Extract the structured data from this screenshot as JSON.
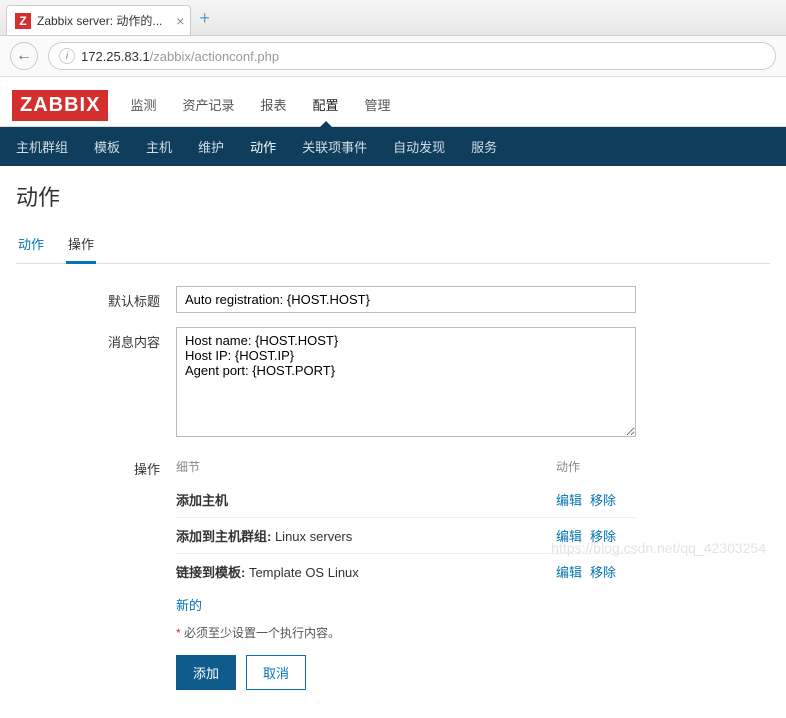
{
  "browser": {
    "tab_title": "Zabbix server: 动作的...",
    "favicon_letter": "Z",
    "url_host": "172.25.83.1",
    "url_path": "/zabbix/actionconf.php"
  },
  "header": {
    "logo": "ZABBIX",
    "top_nav": [
      "监测",
      "资产记录",
      "报表",
      "配置",
      "管理"
    ],
    "top_nav_active": 3,
    "sub_nav": [
      "主机群组",
      "模板",
      "主机",
      "维护",
      "动作",
      "关联项事件",
      "自动发现",
      "服务"
    ],
    "sub_nav_active": 4
  },
  "page": {
    "title": "动作",
    "inner_tabs": [
      "动作",
      "操作"
    ],
    "inner_tab_active": 1
  },
  "form": {
    "labels": {
      "subject": "默认标题",
      "message": "消息内容",
      "operations": "操作"
    },
    "subject_value": "Auto registration: {HOST.HOST}",
    "message_value": "Host name: {HOST.HOST}\nHost IP: {HOST.IP}\nAgent port: {HOST.PORT}",
    "op_head_detail": "细节",
    "op_head_action": "动作",
    "operations": [
      {
        "bold": "添加主机",
        "rest": ""
      },
      {
        "bold": "添加到主机群组:",
        "rest": " Linux servers"
      },
      {
        "bold": "链接到模板:",
        "rest": " Template OS Linux"
      }
    ],
    "link_edit": "编辑",
    "link_remove": "移除",
    "link_new": "新的",
    "note": "必须至少设置一个执行内容。",
    "btn_add": "添加",
    "btn_cancel": "取消"
  },
  "watermark": "https://blog.csdn.net/qq_42303254"
}
